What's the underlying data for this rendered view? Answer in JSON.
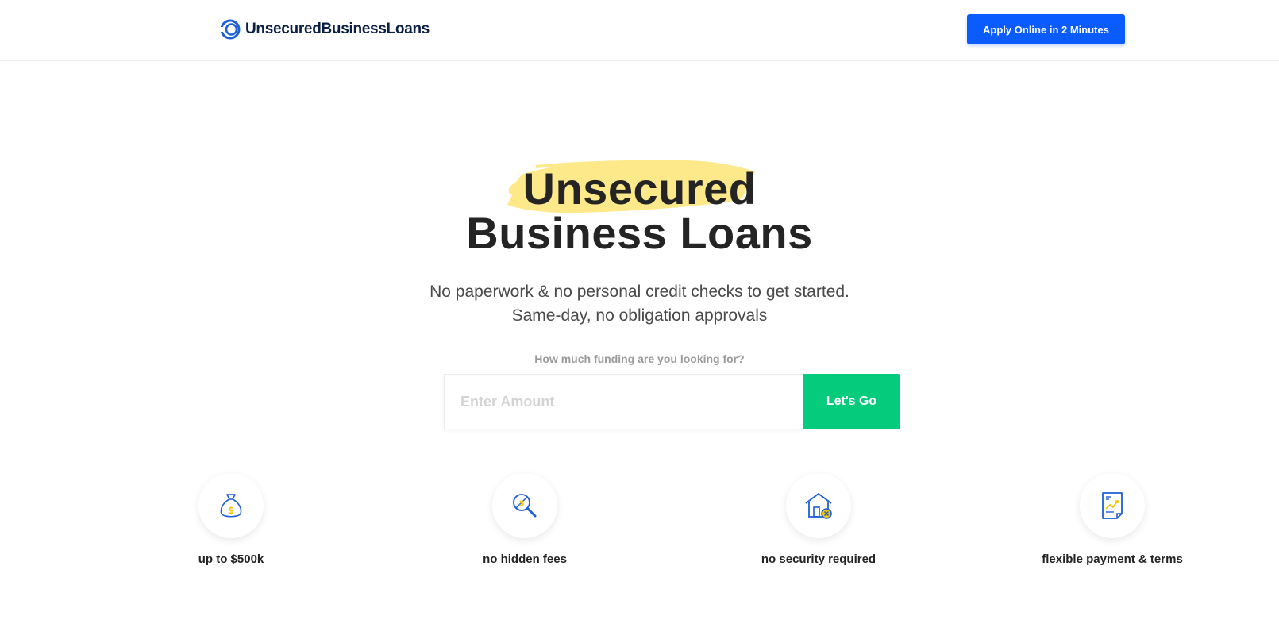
{
  "header": {
    "logo_text": "UnsecuredBusinessLoans",
    "apply_button_label": "Apply Online in 2 Minutes"
  },
  "hero": {
    "title_line1": "Unsecured",
    "title_line2": "Business Loans",
    "subtitle_line1": "No paperwork & no personal credit checks to get started.",
    "subtitle_line2": "Same-day, no obligation approvals",
    "highlight_color": "#fde98a"
  },
  "funding_form": {
    "question": "How much funding are you looking for?",
    "amount_placeholder": "Enter Amount",
    "amount_value": "",
    "submit_label": "Let's Go",
    "submit_color": "#05cc7d"
  },
  "features": [
    {
      "icon": "money-bag-icon",
      "label": "up to $500k"
    },
    {
      "icon": "magnifier-icon",
      "label": "no hidden fees"
    },
    {
      "icon": "house-icon",
      "label": "no security required"
    },
    {
      "icon": "document-chart-icon",
      "label": "flexible payment & terms"
    }
  ],
  "colors": {
    "brand_blue": "#0b5cff",
    "logo_navy": "#0b1f44",
    "icon_blue": "#1e5fd6",
    "icon_yellow": "#f7c600",
    "text_dark": "#242424"
  }
}
